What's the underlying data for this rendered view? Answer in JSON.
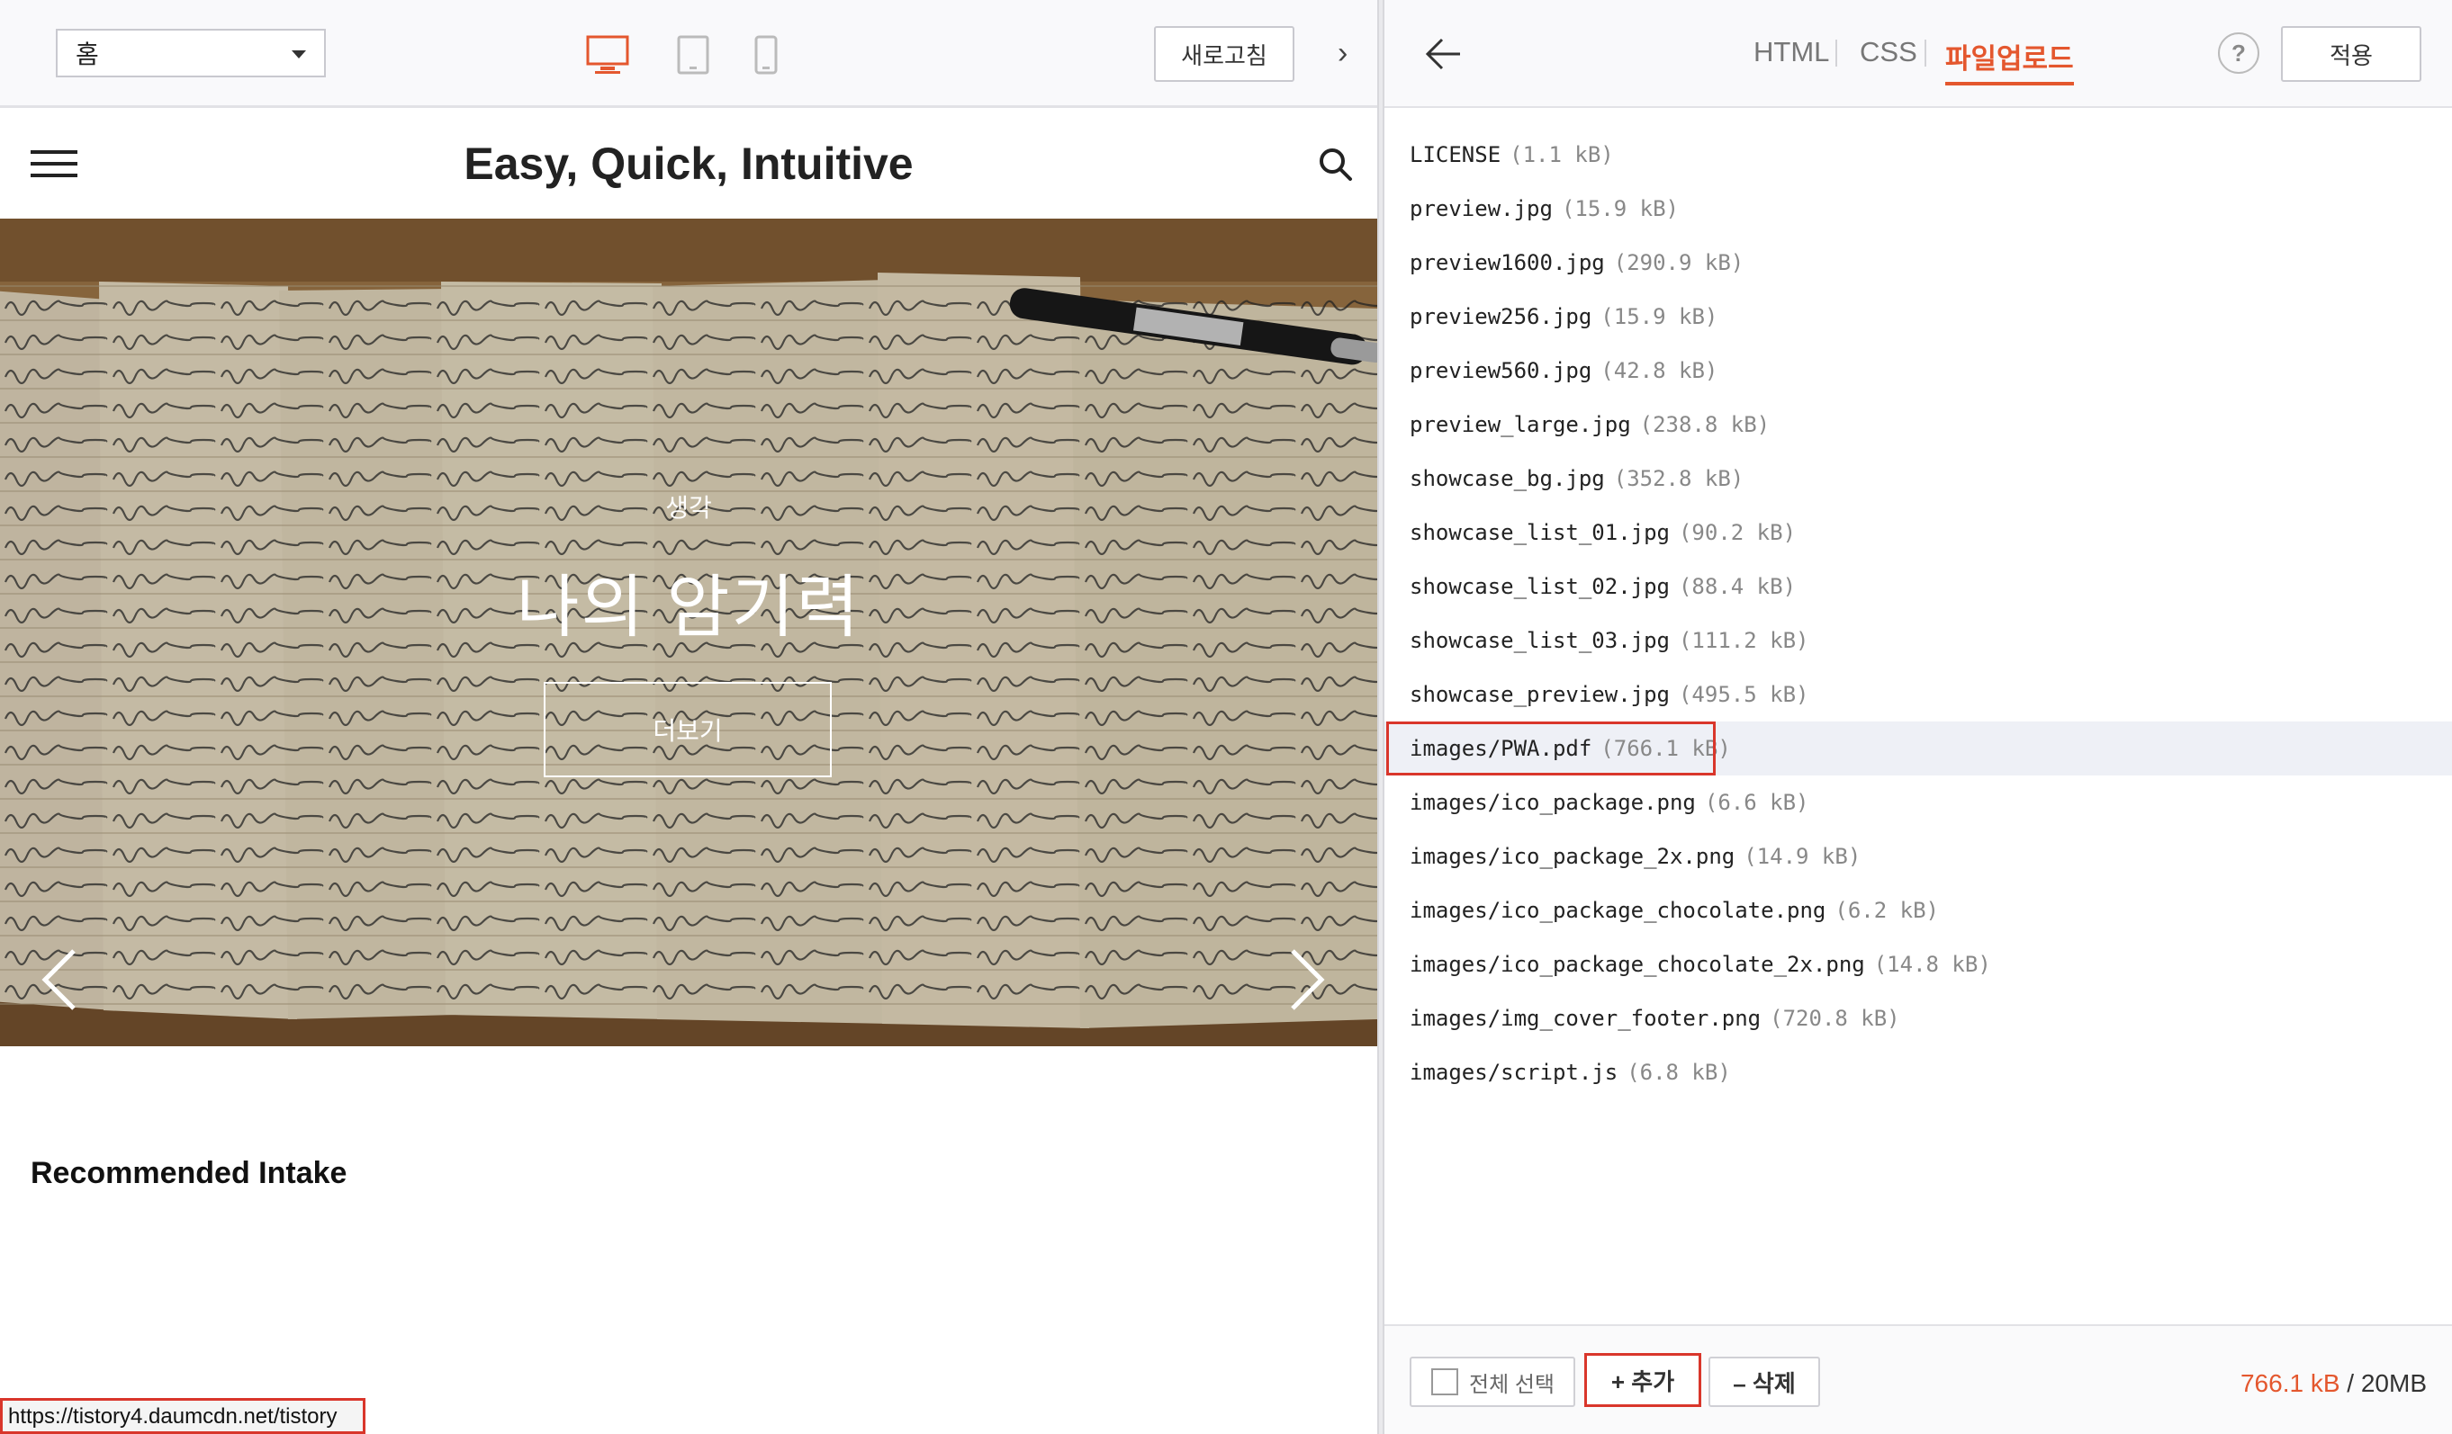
{
  "preview": {
    "page_select": {
      "selected": "홈"
    },
    "refresh_label": "새로고침",
    "site": {
      "title": "Easy, Quick, Intuitive",
      "hero": {
        "category": "생각",
        "title": "나의 암기력",
        "more_label": "더보기"
      },
      "section_title": "Recommended Intake"
    },
    "status_url": "https://tistory4.daumcdn.net/tistory"
  },
  "editor": {
    "tabs": [
      {
        "label": "HTML",
        "active": false
      },
      {
        "label": "CSS",
        "active": false
      },
      {
        "label": "파일업로드",
        "active": true
      }
    ],
    "help_label": "?",
    "apply_label": "적용",
    "files": [
      {
        "name": "LICENSE",
        "size": "(1.1 kB)"
      },
      {
        "name": "preview.jpg",
        "size": "(15.9 kB)"
      },
      {
        "name": "preview1600.jpg",
        "size": "(290.9 kB)"
      },
      {
        "name": "preview256.jpg",
        "size": "(15.9 kB)"
      },
      {
        "name": "preview560.jpg",
        "size": "(42.8 kB)"
      },
      {
        "name": "preview_large.jpg",
        "size": "(238.8 kB)"
      },
      {
        "name": "showcase_bg.jpg",
        "size": "(352.8 kB)"
      },
      {
        "name": "showcase_list_01.jpg",
        "size": "(90.2 kB)"
      },
      {
        "name": "showcase_list_02.jpg",
        "size": "(88.4 kB)"
      },
      {
        "name": "showcase_list_03.jpg",
        "size": "(111.2 kB)"
      },
      {
        "name": "showcase_preview.jpg",
        "size": "(495.5 kB)"
      },
      {
        "name": "images/PWA.pdf",
        "size": "(766.1 kB)",
        "selected": true
      },
      {
        "name": "images/ico_package.png",
        "size": "(6.6 kB)"
      },
      {
        "name": "images/ico_package_2x.png",
        "size": "(14.9 kB)"
      },
      {
        "name": "images/ico_package_chocolate.png",
        "size": "(6.2 kB)"
      },
      {
        "name": "images/ico_package_chocolate_2x.png",
        "size": "(14.8 kB)"
      },
      {
        "name": "images/img_cover_footer.png",
        "size": "(720.8 kB)"
      },
      {
        "name": "images/script.js",
        "size": "(6.8 kB)"
      }
    ],
    "footer": {
      "select_all_label": "전체 선택",
      "add_label": "+ 추가",
      "delete_label": "– 삭제",
      "usage_used": "766.1 kB",
      "usage_limit": "/ 20MB"
    }
  },
  "colors": {
    "accent": "#e4572e",
    "highlight_border": "#d9362b",
    "selected_row": "#eef0f6"
  },
  "icons": [
    "chevron-down-icon",
    "desktop-icon",
    "tablet-icon",
    "mobile-icon",
    "chevron-right-icon",
    "menu-icon",
    "search-icon",
    "arrow-left-icon",
    "chevron-left-icon"
  ]
}
